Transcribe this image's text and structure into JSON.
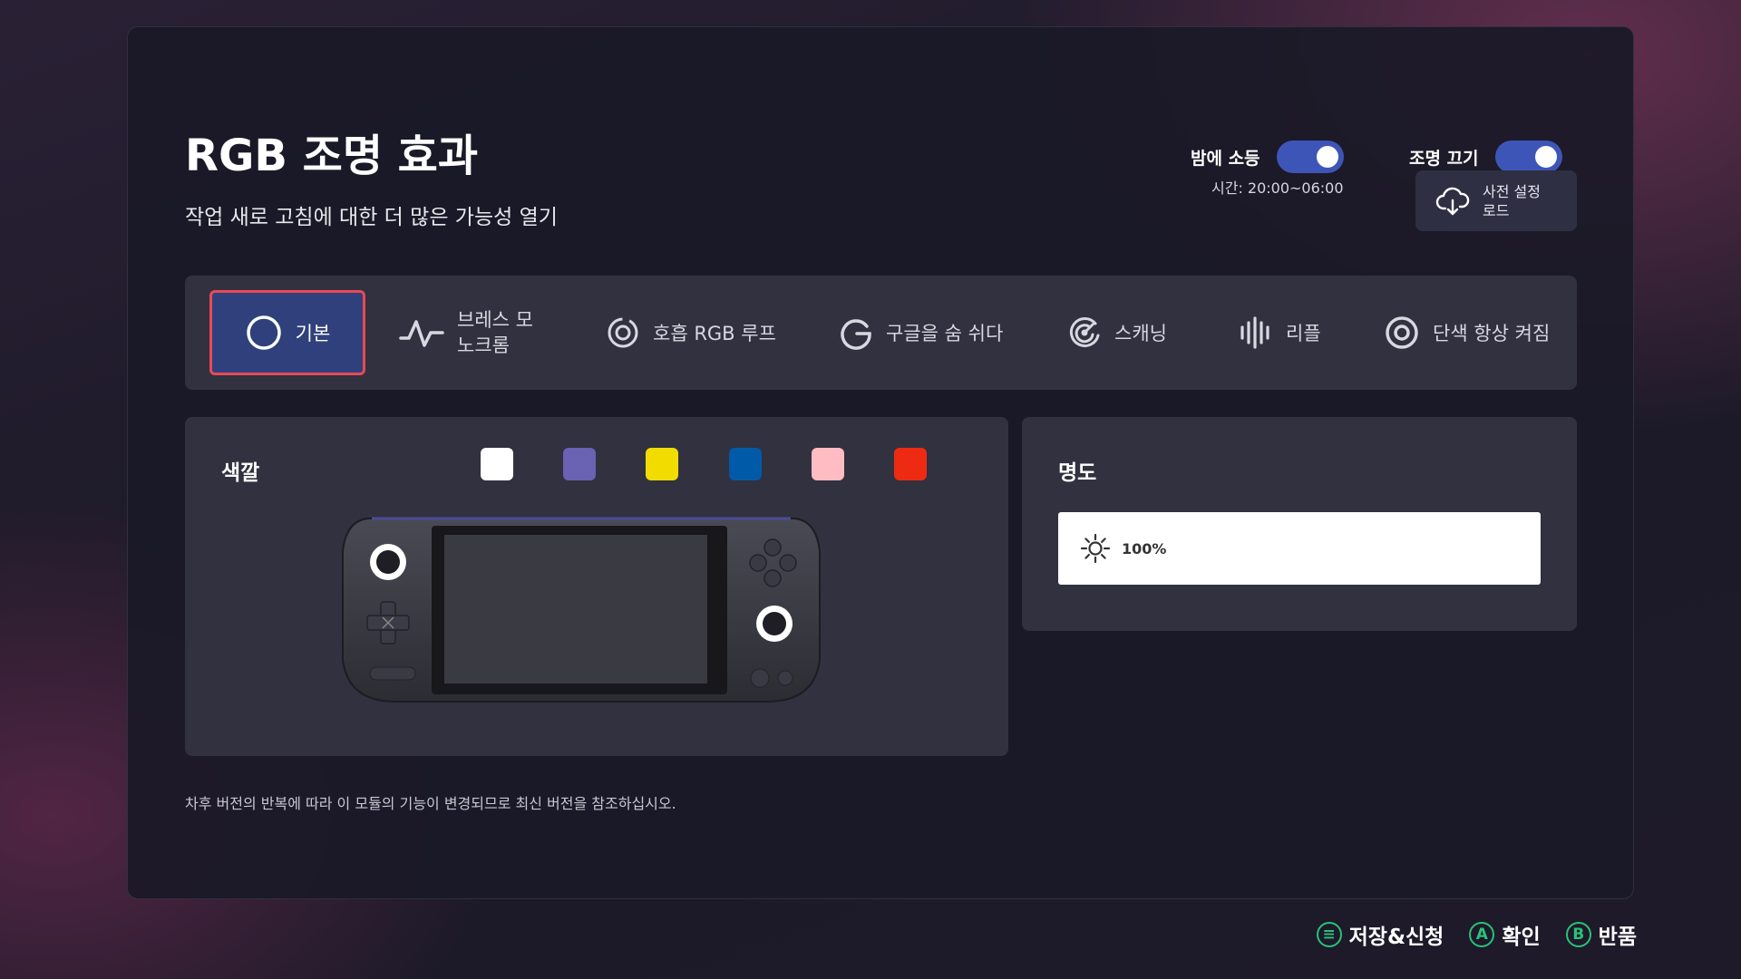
{
  "header": {
    "title": "RGB 조명 효과",
    "subtitle": "작업 새로 고침에 대한 더 많은 가능성 열기"
  },
  "toggles": [
    {
      "label": "밤에 소등",
      "on": true,
      "detail": "시간: 20:00~06:00",
      "icon": "toggle-switch"
    },
    {
      "label": "조명 끄기",
      "on": true,
      "icon": "toggle-switch"
    }
  ],
  "preset_button": {
    "label": "사전 설정 로드",
    "icon": "cloud-download-icon"
  },
  "tabs": [
    {
      "label": "기본",
      "icon": "circle-icon",
      "active": true
    },
    {
      "label": "브레스 모노크롬",
      "icon": "pulse-wave-icon",
      "active": false
    },
    {
      "label": "호흡 RGB 루프",
      "icon": "breathing-loop-icon",
      "active": false
    },
    {
      "label": "구글을 숨 쉬다",
      "icon": "google-g-icon",
      "active": false
    },
    {
      "label": "스캐닝",
      "icon": "scanning-icon",
      "active": false
    },
    {
      "label": "리플",
      "icon": "ripple-bars-icon",
      "active": false
    },
    {
      "label": "단색 항상 켜짐",
      "icon": "ring-icon",
      "active": false
    }
  ],
  "color_section": {
    "label": "색깔",
    "swatches": [
      "#ffffff",
      "#6a62b2",
      "#f2dc00",
      "#005aa8",
      "#ffbcc2",
      "#ee2a12"
    ]
  },
  "brightness": {
    "label": "명도",
    "value_text": "100%",
    "value": 1.0,
    "icon": "sun-icon"
  },
  "disclaimer": "차후 버전의 반복에 따라 이 모듈의 기능이 변경되므로 최신 버전을 참조하십시오.",
  "footer": [
    {
      "icon": "menu-icon",
      "glyph": "≡",
      "label": "저장&신청"
    },
    {
      "icon": "a-button-icon",
      "glyph": "A",
      "label": "확인"
    },
    {
      "icon": "b-button-icon",
      "glyph": "B",
      "label": "반품"
    }
  ],
  "colors": {
    "accent": "#3e55b8",
    "active_border": "#e84a55",
    "footer_green": "#29c27a"
  }
}
